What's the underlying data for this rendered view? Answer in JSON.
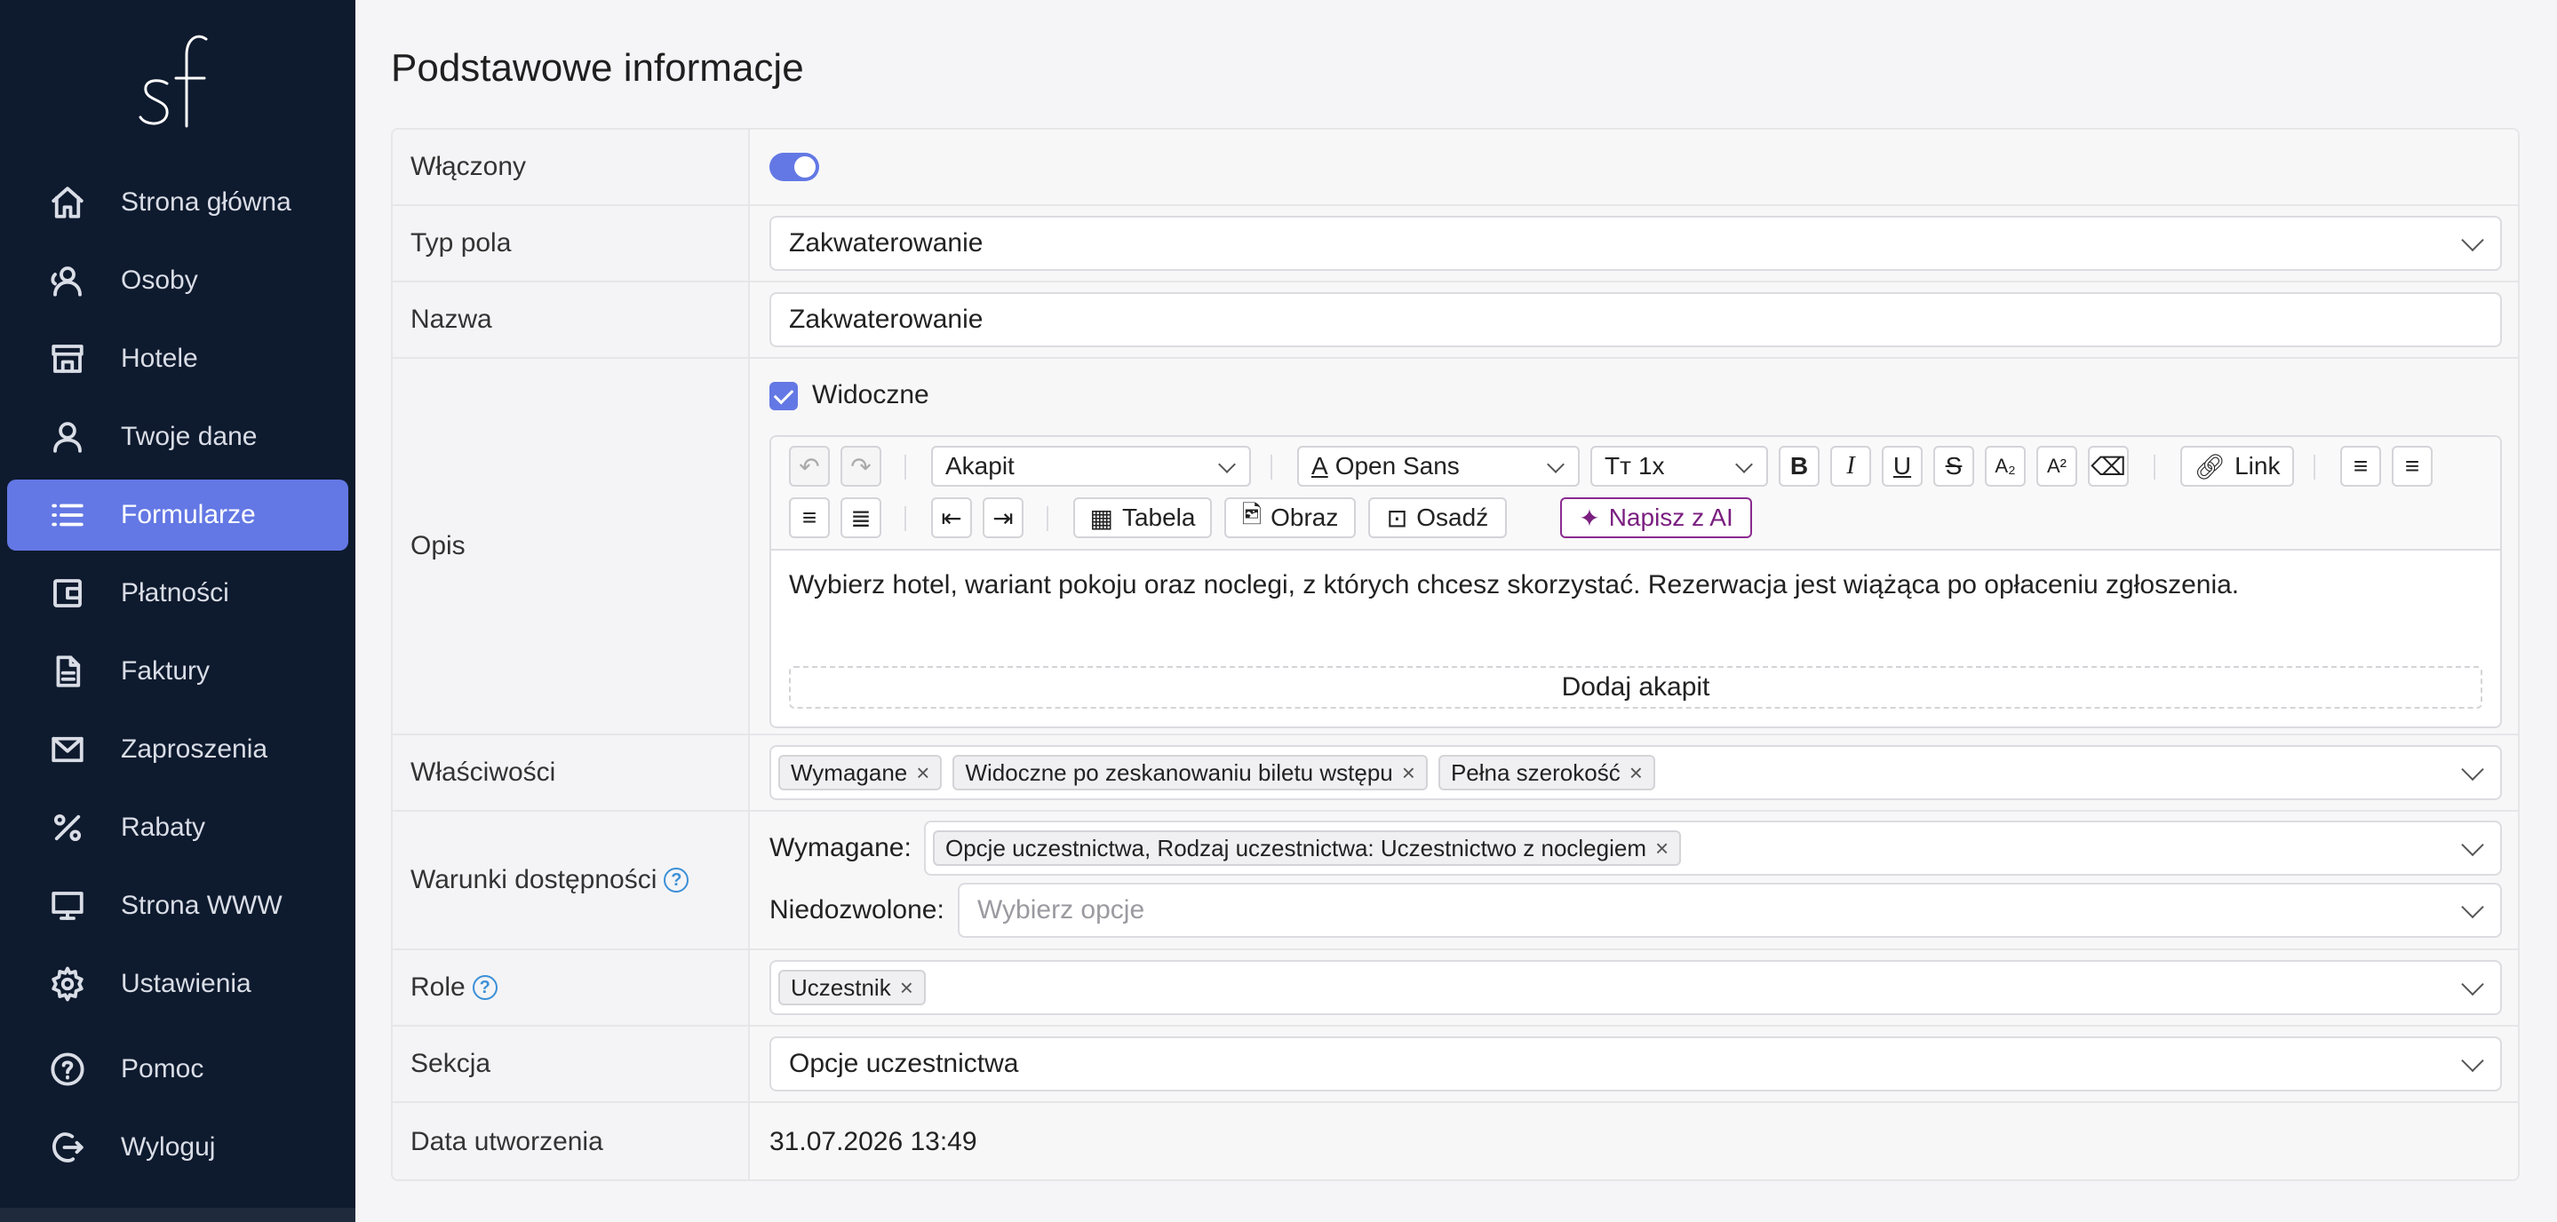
{
  "sidebar": {
    "logo_text": "sf",
    "items": [
      {
        "label": "Strona główna",
        "icon": "home-icon"
      },
      {
        "label": "Osoby",
        "icon": "users-icon"
      },
      {
        "label": "Hotele",
        "icon": "store-icon"
      },
      {
        "label": "Twoje dane",
        "icon": "user-icon"
      },
      {
        "label": "Formularze",
        "icon": "list-icon",
        "active": true
      },
      {
        "label": "Płatności",
        "icon": "wallet-icon"
      },
      {
        "label": "Faktury",
        "icon": "document-icon"
      },
      {
        "label": "Zaproszenia",
        "icon": "mail-icon"
      },
      {
        "label": "Rabaty",
        "icon": "percent-icon"
      },
      {
        "label": "Strona WWW",
        "icon": "monitor-icon"
      },
      {
        "label": "Ustawienia",
        "icon": "gear-icon"
      },
      {
        "label": "Pomoc",
        "icon": "help-icon"
      },
      {
        "label": "Wyloguj",
        "icon": "logout-icon"
      }
    ]
  },
  "page": {
    "title": "Podstawowe informacje"
  },
  "form": {
    "enabled": {
      "label": "Włączony",
      "value": true
    },
    "field_type": {
      "label": "Typ pola",
      "value": "Zakwaterowanie"
    },
    "name": {
      "label": "Nazwa",
      "value": "Zakwaterowanie"
    },
    "description": {
      "label": "Opis",
      "visible_label": "Widoczne",
      "visible_checked": true,
      "toolbar": {
        "block_type": "Akapit",
        "font": "Open Sans",
        "font_size": "1x",
        "link": "Link",
        "table": "Tabela",
        "image": "Obraz",
        "embed": "Osadź",
        "ai": "Napisz z AI"
      },
      "text": "Wybierz hotel, wariant pokoju oraz noclegi, z których chcesz skorzystać. Rezerwacja jest wiążąca po opłaceniu zgłoszenia.",
      "add_paragraph": "Dodaj akapit"
    },
    "properties": {
      "label": "Właściwości",
      "tags": [
        "Wymagane",
        "Widoczne po zeskanowaniu biletu wstępu",
        "Pełna szerokość"
      ]
    },
    "availability": {
      "label": "Warunki dostępności",
      "required_label": "Wymagane:",
      "required_tags": [
        "Opcje uczestnictwa, Rodzaj uczestnictwa: Uczestnictwo z noclegiem"
      ],
      "forbidden_label": "Niedozwolone:",
      "forbidden_placeholder": "Wybierz opcje"
    },
    "roles": {
      "label": "Role",
      "tags": [
        "Uczestnik"
      ]
    },
    "section": {
      "label": "Sekcja",
      "value": "Opcje uczestnictwa"
    },
    "created": {
      "label": "Data utworzenia",
      "value": "31.07.2026 13:49"
    }
  },
  "colors": {
    "sidebar_bg": "#0e1a2e",
    "accent": "#6378e4",
    "ai_purple": "#8a2b8f",
    "help_blue": "#3b8fd6"
  }
}
